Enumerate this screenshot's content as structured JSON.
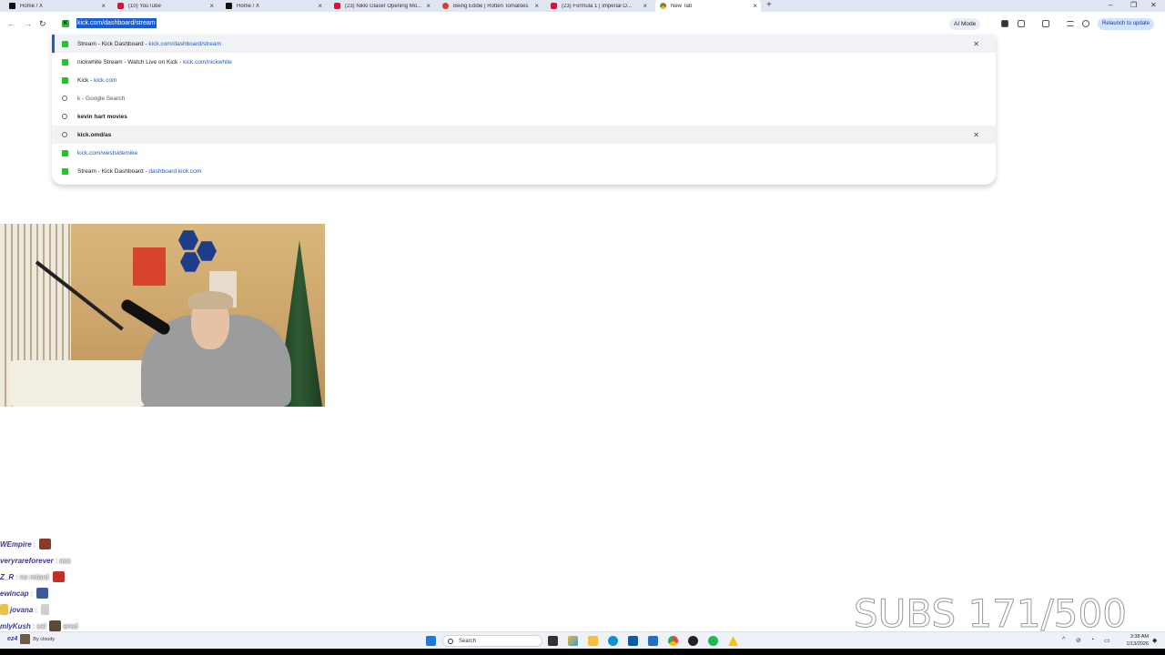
{
  "browser": {
    "tabs": [
      {
        "label": "Home / X",
        "favicon": "x-icon"
      },
      {
        "label": "(10) YouTube",
        "favicon": "youtube-icon"
      },
      {
        "label": "Home / X",
        "favicon": "x-icon"
      },
      {
        "label": "(23) Nikki Glaser Opening Mo...",
        "favicon": "youtube-icon"
      },
      {
        "label": "Being Eddie | Rotten Tomatoes",
        "favicon": "rotten-tomatoes-icon"
      },
      {
        "label": "(23) Formula 1 | Imperial O...",
        "favicon": "youtube-icon"
      },
      {
        "label": "New Tab",
        "favicon": "chrome-icon"
      }
    ],
    "omnibox_value": "kick.com/dashboard/stream",
    "ai_mode_label": "AI Mode",
    "relaunch_label": "Relaunch to update"
  },
  "suggestions": [
    {
      "title": "Stream - Kick Dashboard - ",
      "url": "kick.com/dashboard/stream",
      "icon": "kick-icon",
      "removable": true,
      "selected": true
    },
    {
      "title": "nickwhite Stream - Watch Live on Kick - ",
      "url": "kick.com/nickwhite",
      "icon": "kick-icon",
      "removable": false
    },
    {
      "title": "Kick - ",
      "url": "kick.com",
      "icon": "kick-icon",
      "removable": false
    },
    {
      "title": "k - Google Search",
      "url": "",
      "icon": "search-icon",
      "removable": false
    },
    {
      "title": "kevin hart movies",
      "url": "",
      "icon": "history-icon",
      "removable": false,
      "bold": true
    },
    {
      "title": "kick.omd/as",
      "url": "",
      "icon": "history-icon",
      "removable": true,
      "bold": true,
      "hover": true
    },
    {
      "title": "",
      "url": "kick.com/westsidemike",
      "icon": "kick-icon",
      "removable": false
    },
    {
      "title": "Stream - Kick Dashboard - ",
      "url": "dashboard.kick.com",
      "icon": "kick-icon",
      "removable": false
    }
  ],
  "chat": [
    {
      "user": "WEmpire",
      "msg": ":",
      "emote": "#8a3a2a"
    },
    {
      "user": "veryrareforever",
      "msg": ": ass",
      "emote": ""
    },
    {
      "user": "Z_R",
      "msg": ": no retard",
      "emote": "#c0302a"
    },
    {
      "user": "ewincap",
      "msg": ":",
      "emote": "#3a5a9a"
    },
    {
      "user": "jovana",
      "msg": ":",
      "emote": "#cfcfcf"
    },
    {
      "user": "mlyKush",
      "msg": ": sal",
      "emote": "#5a4a3a",
      "suffix": "ered"
    },
    {
      "user": "ez4",
      "msg": "",
      "emote": "#444444",
      "suffix": "By cloudy"
    }
  ],
  "overlay": {
    "subs_text": "SUBS 171/500"
  },
  "taskbar": {
    "search_placeholder": "Search",
    "time": "3:38 AM",
    "date": "1/13/2026"
  },
  "colors": {
    "kick_green": "#22c32e",
    "selection_blue": "#1a5bd6",
    "tab_strip": "#dfe6f1"
  }
}
